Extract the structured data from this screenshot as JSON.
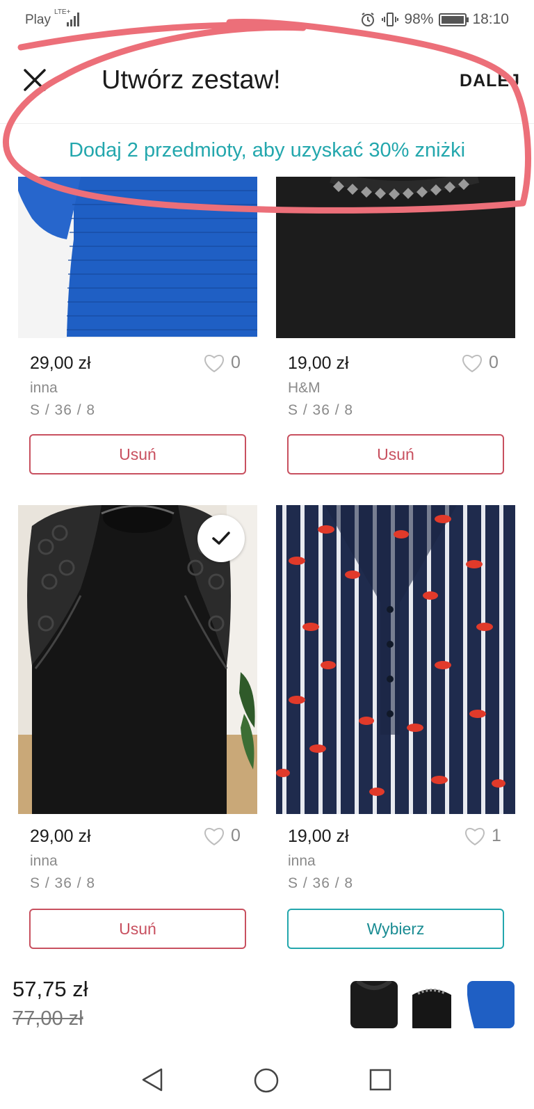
{
  "status_bar": {
    "carrier": "Play",
    "network": "LTE+",
    "battery": "98%",
    "time": "18:10"
  },
  "header": {
    "title": "Utwórz zestaw!",
    "next_label": "DALEJ"
  },
  "promo_text": "Dodaj 2 przedmioty, aby uzyskać 30% zniżki",
  "products": [
    {
      "price": "29,00 zł",
      "brand": "inna",
      "size": "S / 36 / 8",
      "likes": "0",
      "button": "Usuń",
      "selected": false,
      "image": "blue knit sweater"
    },
    {
      "price": "19,00 zł",
      "brand": "H&M",
      "size": "S / 36 / 8",
      "likes": "0",
      "button": "Usuń",
      "selected": false,
      "image": "black top with studded neckline"
    },
    {
      "price": "29,00 zł",
      "brand": "inna",
      "size": "S / 36 / 8",
      "likes": "0",
      "button": "Usuń",
      "selected": true,
      "image": "black lace-shoulder top"
    },
    {
      "price": "19,00 zł",
      "brand": "inna",
      "size": "S / 36 / 8",
      "likes": "1",
      "button": "Wybierz",
      "selected": false,
      "image": "navy striped blouse with red lips print"
    }
  ],
  "footer": {
    "total_price": "57,75 zł",
    "old_price": "77,00 zł"
  },
  "colors": {
    "accent_teal": "#23a7ad",
    "remove_red": "#c8505f",
    "annotation": "#ec6f79"
  },
  "icons": [
    "close-icon",
    "heart-icon",
    "check-icon",
    "back-icon",
    "home-icon",
    "recents-icon",
    "alarm-icon",
    "vibrate-icon",
    "battery-icon",
    "signal-icon"
  ]
}
